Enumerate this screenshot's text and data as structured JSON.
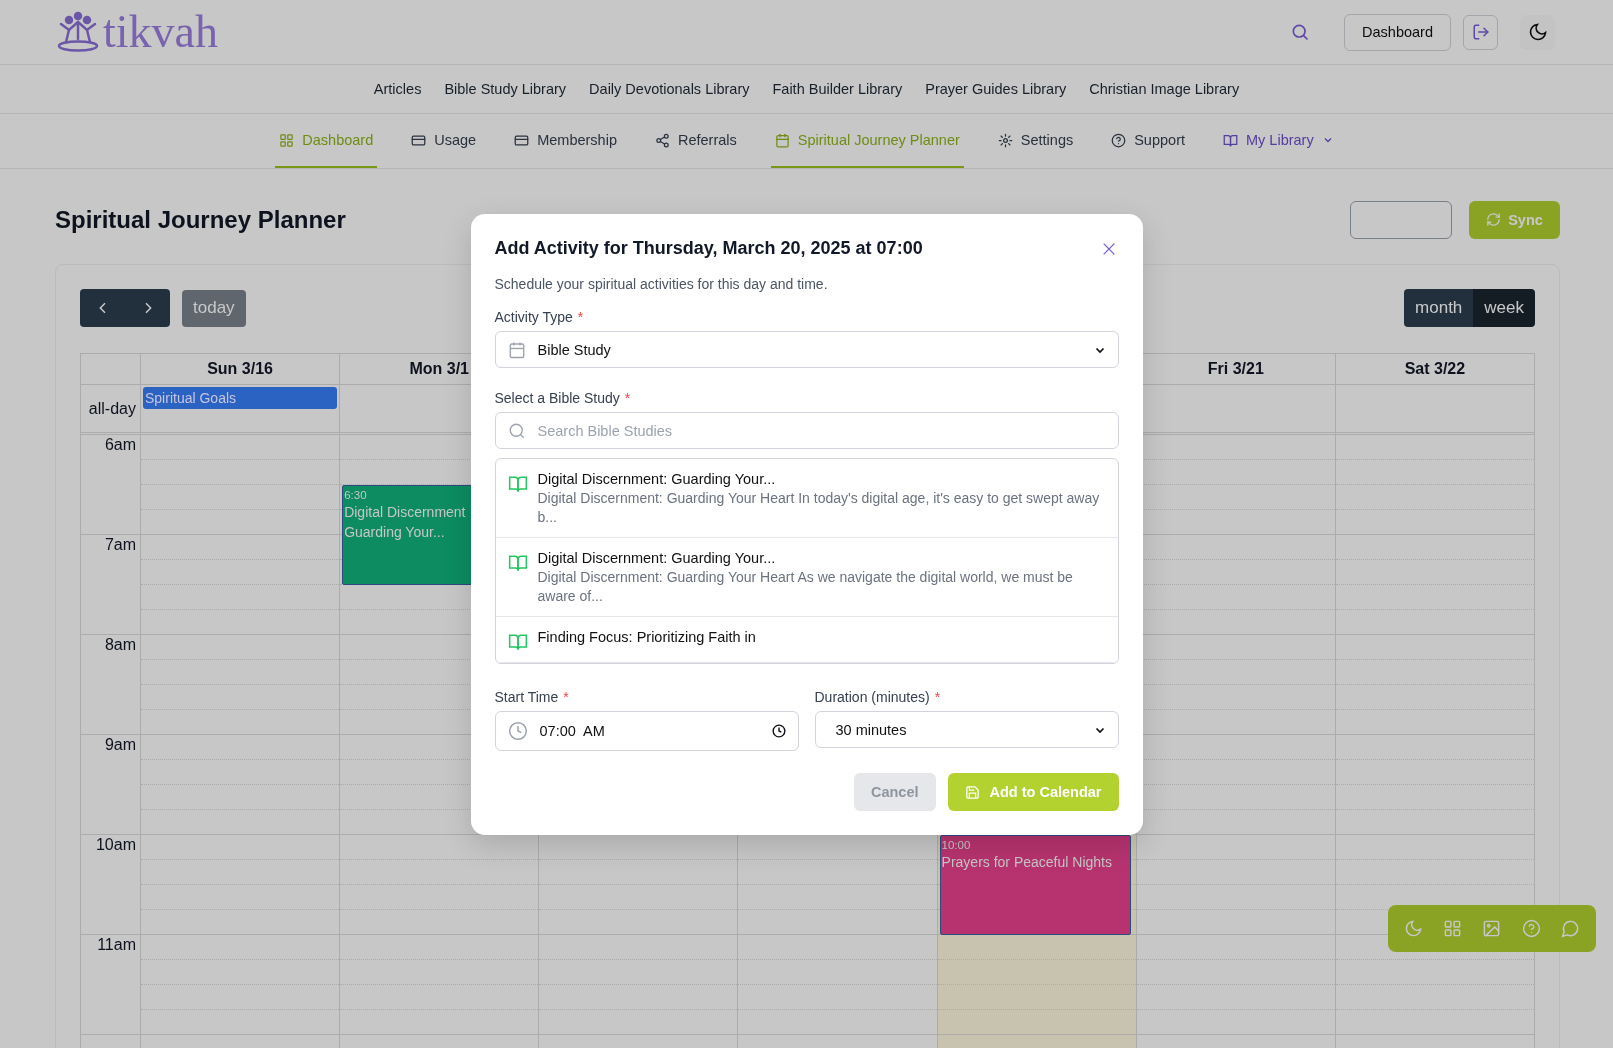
{
  "brand": {
    "name": "tikvah"
  },
  "header": {
    "dashboard_button": "Dashboard"
  },
  "nav_links": [
    "Articles",
    "Bible Study Library",
    "Daily Devotionals Library",
    "Faith Builder Library",
    "Prayer Guides Library",
    "Christian Image Library"
  ],
  "tabs": [
    {
      "label": "Dashboard",
      "kind": "link",
      "selected": true
    },
    {
      "label": "Usage",
      "kind": "link",
      "selected": false
    },
    {
      "label": "Membership",
      "kind": "link",
      "selected": false
    },
    {
      "label": "Referrals",
      "kind": "link",
      "selected": false
    },
    {
      "label": "Spiritual Journey Planner",
      "kind": "link",
      "selected": true
    },
    {
      "label": "Settings",
      "kind": "link",
      "selected": false
    },
    {
      "label": "Support",
      "kind": "link",
      "selected": false
    },
    {
      "label": "My Library",
      "kind": "menu",
      "selected": false
    }
  ],
  "page": {
    "title": "Spiritual Journey Planner",
    "sync_button": "Sync"
  },
  "calendar": {
    "today_button": "today",
    "all_day_label": "all-day",
    "views": [
      {
        "label": "month",
        "selected": false
      },
      {
        "label": "week",
        "selected": true
      }
    ],
    "days": [
      {
        "label": "Sun 3/16",
        "today": false,
        "all_day_events": [
          {
            "title": "Spiritual Goals",
            "color": "#2b63c2"
          }
        ]
      },
      {
        "label": "Mon 3/1",
        "today": false,
        "events": [
          {
            "time": "6:30",
            "title": "Digital Discernment Guarding Your...",
            "color": "#0c8c60"
          }
        ]
      },
      {
        "today": false
      },
      {
        "today": false
      },
      {
        "today": true,
        "events": [
          {
            "time": "10:00",
            "title": "Prayers for Peaceful Nights",
            "color": "#b7336f"
          }
        ]
      },
      {
        "label": "Fri 3/21",
        "today": false
      },
      {
        "label": "Sat 3/22",
        "today": false
      }
    ],
    "hours": [
      "6am",
      "7am",
      "8am",
      "9am",
      "10am",
      "11am"
    ]
  },
  "modal": {
    "title": "Add Activity for Thursday, March 20, 2025 at 07:00",
    "subtitle": "Schedule your spiritual activities for this day and time.",
    "activity_type": {
      "label": "Activity Type",
      "marker": "*",
      "value": "Bible Study"
    },
    "study": {
      "label": "Select a Bible Study",
      "marker": "*",
      "search_placeholder": "Search Bible Studies",
      "items": [
        {
          "title": "Digital Discernment: Guarding Your...",
          "description": "Digital Discernment: Guarding Your Heart In today's digital age, it's easy to get swept away b..."
        },
        {
          "title": "Digital Discernment: Guarding Your...",
          "description": "Digital Discernment: Guarding Your Heart As we navigate the digital world, we must be aware of..."
        },
        {
          "title": "Finding Focus: Prioritizing Faith in"
        }
      ]
    },
    "start_time": {
      "label": "Start Time",
      "marker": "*",
      "value": "07:00  AM"
    },
    "duration": {
      "label": "Duration (minutes)",
      "marker": "*",
      "value": "30 minutes"
    },
    "cancel": {
      "label": "Cancel",
      "disabled": true
    },
    "submit": "Add to Calendar"
  }
}
